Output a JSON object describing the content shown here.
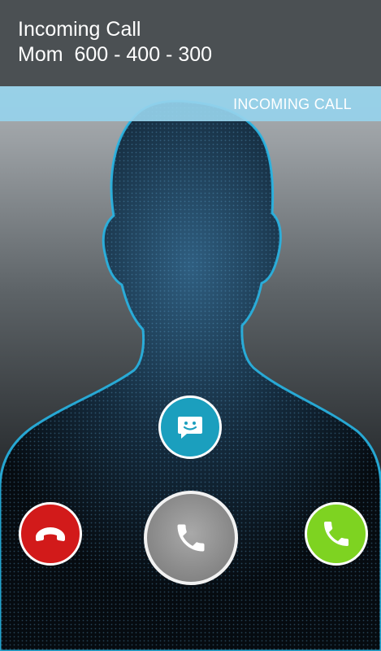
{
  "header": {
    "title": "Incoming Call",
    "caller_name": "Mom",
    "caller_number": "600 - 400 - 300"
  },
  "status": {
    "label": "INCOMING CALL"
  },
  "actions": {
    "message_icon": "message-smile-icon",
    "decline_icon": "phone-hangup-icon",
    "answer_icon": "phone-icon",
    "accept_icon": "phone-icon"
  },
  "colors": {
    "header_bg": "#4b5053",
    "status_bar_bg": "#96d2eb",
    "decline": "#d21a1a",
    "accept": "#7ed321",
    "message": "#1b9fbe",
    "answer_handle": "#8a8a8a",
    "silhouette_glow": "#27b6e6"
  }
}
